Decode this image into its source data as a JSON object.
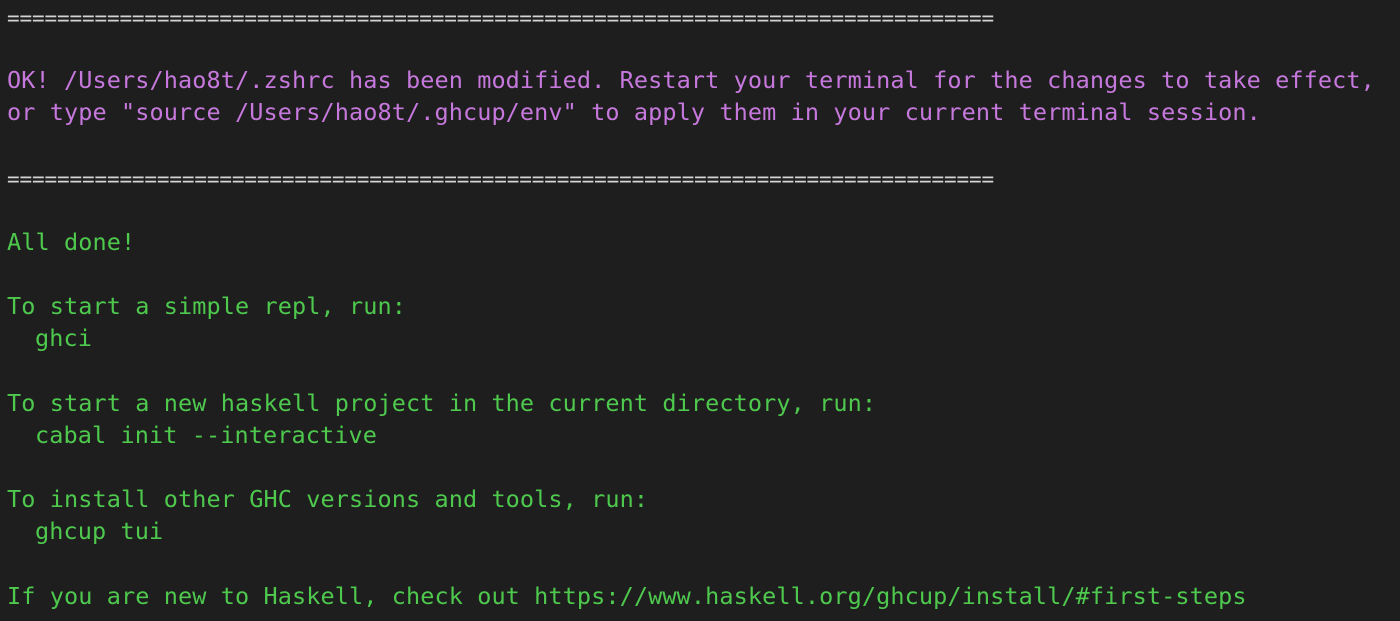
{
  "colors": {
    "background": "#1e1e1e",
    "separator": "#d4d4d4",
    "notice": "#c678dd",
    "success": "#4ec94e"
  },
  "terminal": {
    "separator_top": "===============================================================================",
    "notice_line_1": "OK! /Users/hao8t/.zshrc has been modified. Restart your terminal for the changes to take effect,",
    "notice_line_2": "or type \"source /Users/hao8t/.ghcup/env\" to apply them in your current terminal session.",
    "separator_bottom": "===============================================================================",
    "done": "All done!",
    "repl_intro": "To start a simple repl, run:",
    "repl_cmd": "ghci",
    "project_intro": "To start a new haskell project in the current directory, run:",
    "project_cmd": "cabal init --interactive",
    "tools_intro": "To install other GHC versions and tools, run:",
    "tools_cmd": "ghcup tui",
    "newcomer": "If you are new to Haskell, check out https://www.haskell.org/ghcup/install/#first-steps"
  }
}
